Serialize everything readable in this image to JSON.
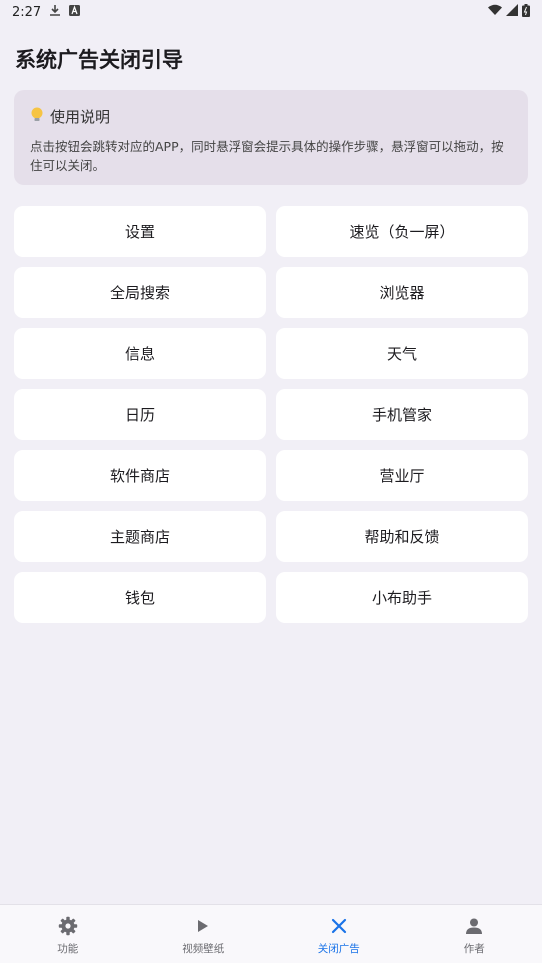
{
  "status_bar": {
    "time": "2:27"
  },
  "page_title": "系统广告关闭引导",
  "info": {
    "title": "使用说明",
    "text": "点击按钮会跳转对应的APP，同时悬浮窗会提示具体的操作步骤，悬浮窗可以拖动，按住可以关闭。"
  },
  "buttons": [
    "设置",
    "速览（负一屏）",
    "全局搜索",
    "浏览器",
    "信息",
    "天气",
    "日历",
    "手机管家",
    "软件商店",
    "营业厅",
    "主题商店",
    "帮助和反馈",
    "钱包",
    "小布助手"
  ],
  "nav": [
    {
      "label": "功能",
      "icon": "gear-icon",
      "active": false
    },
    {
      "label": "视频壁纸",
      "icon": "play-icon",
      "active": false
    },
    {
      "label": "关闭广告",
      "icon": "close-icon",
      "active": true
    },
    {
      "label": "作者",
      "icon": "person-icon",
      "active": false
    }
  ],
  "colors": {
    "accent": "#1a73e8",
    "card": "#e5dfea",
    "background": "#f1eff6"
  }
}
